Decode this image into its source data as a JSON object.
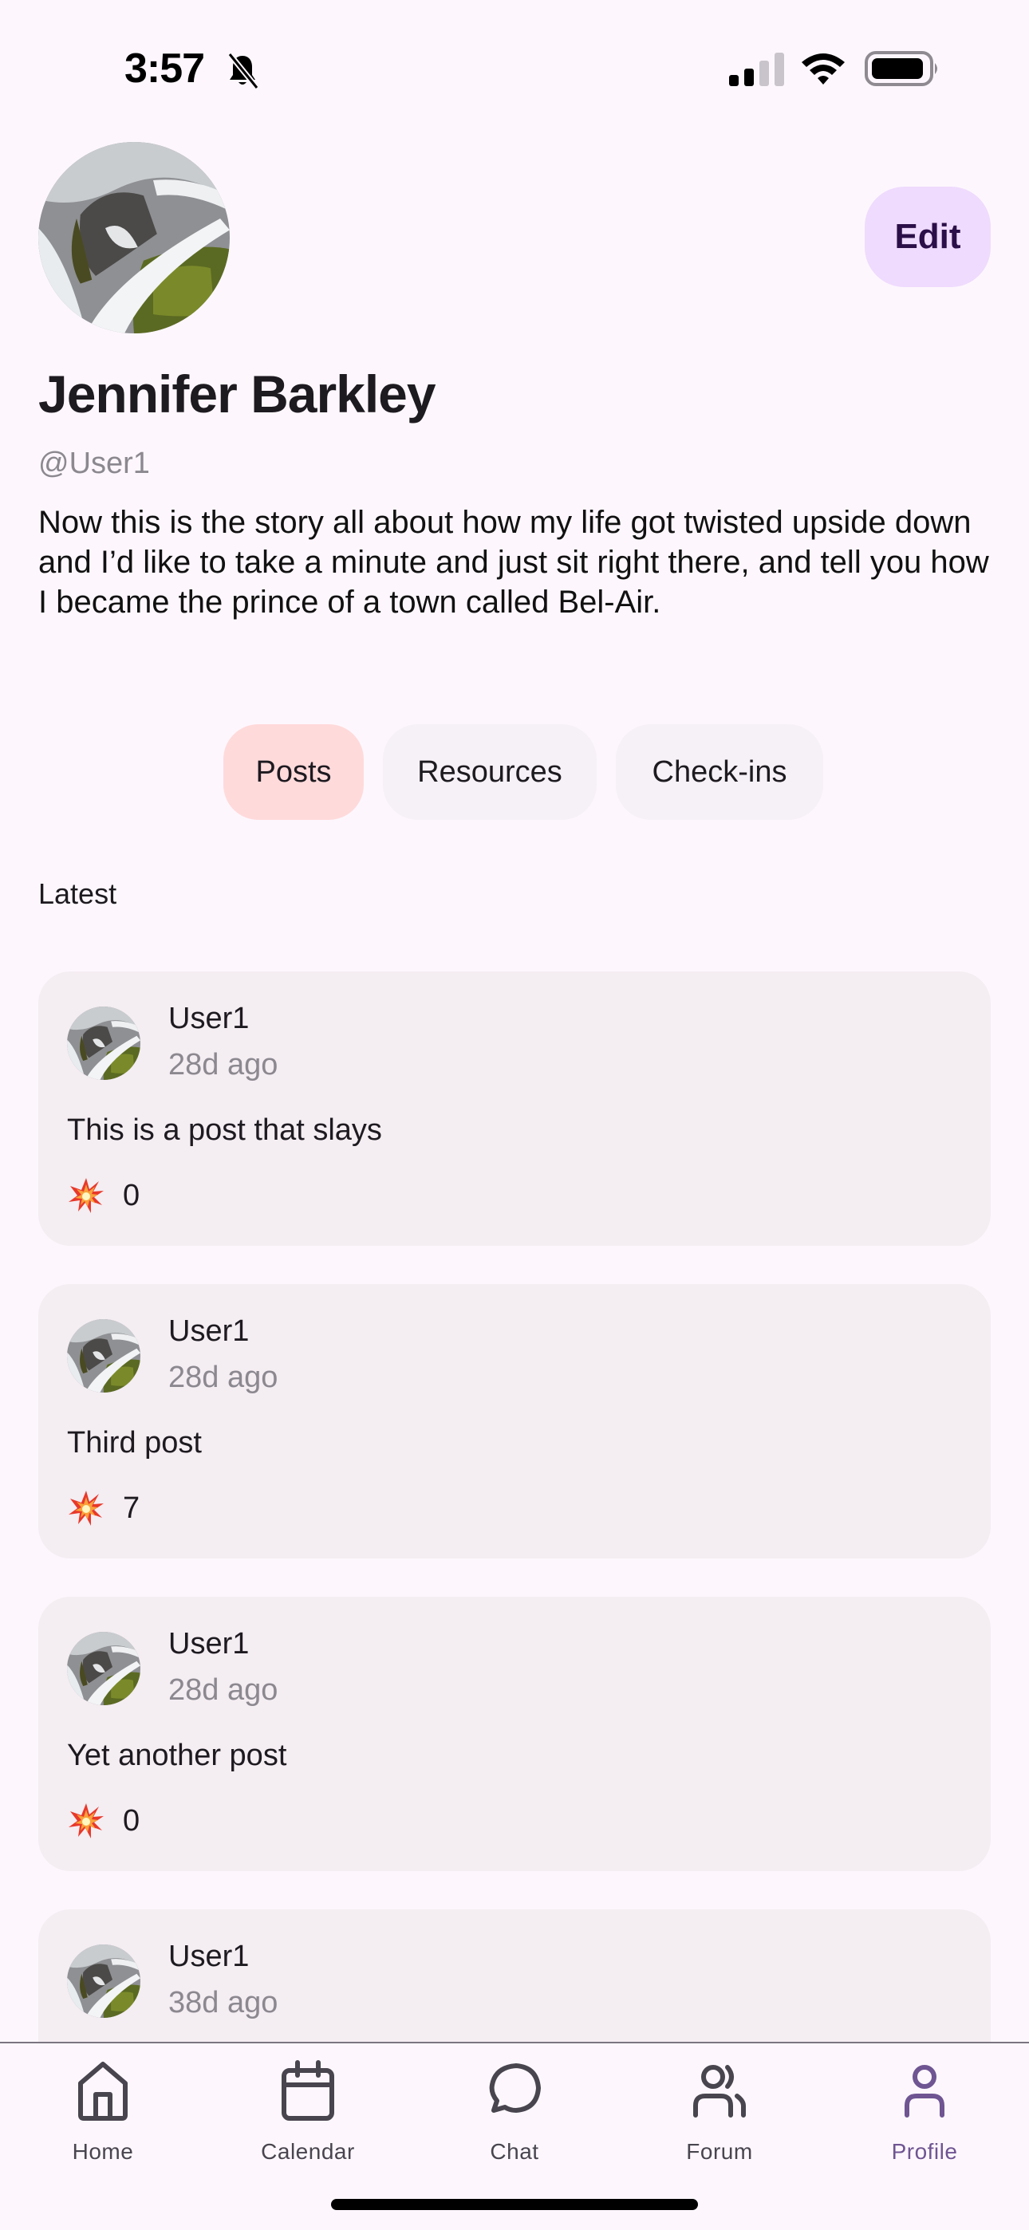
{
  "status_bar": {
    "time": "3:57",
    "silent_icon": "bell-slash-icon",
    "signal_bars_active": 2,
    "signal_bars_total": 4,
    "wifi_icon": "wifi-icon",
    "battery_icon": "battery-icon"
  },
  "profile": {
    "name": "Jennifer Barkley",
    "handle": "@User1",
    "bio": "Now this is the story all about how my life got twisted upside down and I’d like to take a minute and just sit right there, and tell you how I became the prince of a town called Bel-Air.",
    "edit_label": "Edit",
    "avatar_icon": "waterfall-photo"
  },
  "tabs": [
    {
      "label": "Posts",
      "active": true
    },
    {
      "label": "Resources",
      "active": false
    },
    {
      "label": "Check-ins",
      "active": false
    }
  ],
  "section_label": "Latest",
  "posts": [
    {
      "user": "User1",
      "time": "28d ago",
      "text": "This is a post that slays",
      "reaction_icon": "collision-emoji",
      "reaction_count": "0"
    },
    {
      "user": "User1",
      "time": "28d ago",
      "text": "Third post",
      "reaction_icon": "collision-emoji",
      "reaction_count": "7"
    },
    {
      "user": "User1",
      "time": "28d ago",
      "text": "Yet another post",
      "reaction_icon": "collision-emoji",
      "reaction_count": "0"
    },
    {
      "user": "User1",
      "time": "38d ago",
      "text": "",
      "reaction_icon": "collision-emoji",
      "reaction_count": ""
    }
  ],
  "bottom_nav": [
    {
      "label": "Home",
      "icon": "home-icon",
      "active": false
    },
    {
      "label": "Calendar",
      "icon": "calendar-icon",
      "active": false
    },
    {
      "label": "Chat",
      "icon": "chat-bubble-icon",
      "active": false
    },
    {
      "label": "Forum",
      "icon": "people-icon",
      "active": false
    },
    {
      "label": "Profile",
      "icon": "person-icon",
      "active": true
    }
  ],
  "colors": {
    "background": "#fdf7fd",
    "accent": "#6f5592",
    "edit_button_bg": "#efdbfd",
    "edit_button_text": "#2b0f48",
    "active_tab_bg": "#ffdadb",
    "inactive_tab_bg": "#f6f1f7",
    "card_bg": "#f4edf2",
    "secondary_text": "#8c8890"
  }
}
